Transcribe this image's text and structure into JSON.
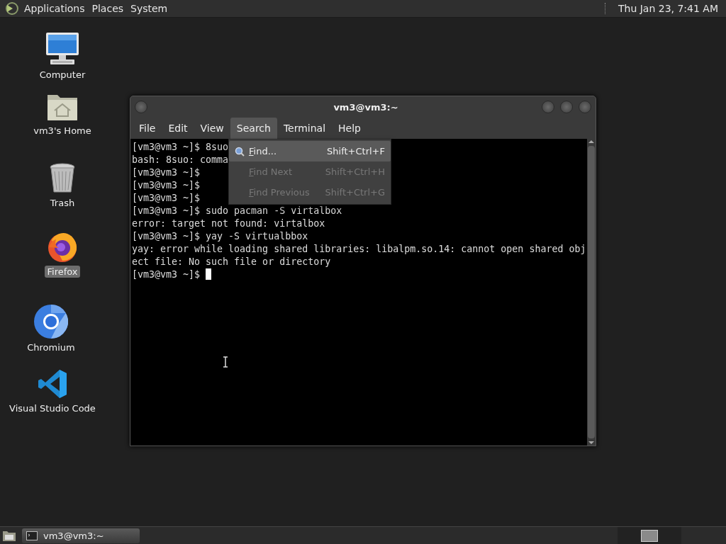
{
  "top_panel": {
    "menus": [
      "Applications",
      "Places",
      "System"
    ],
    "clock": "Thu Jan 23, 7:41 AM"
  },
  "desktop_icons": [
    {
      "label": "Computer",
      "kind": "computer",
      "selected": false
    },
    {
      "label": "vm3's Home",
      "kind": "home",
      "selected": false
    },
    {
      "label": "Trash",
      "kind": "trash",
      "selected": false
    },
    {
      "label": "Firefox",
      "kind": "firefox",
      "selected": true
    },
    {
      "label": "Chromium",
      "kind": "chromium",
      "selected": false
    },
    {
      "label": "Visual Studio Code",
      "kind": "vscode",
      "selected": false
    }
  ],
  "window": {
    "title": "vm3@vm3:~",
    "menus": [
      {
        "label": "File",
        "selected": false
      },
      {
        "label": "Edit",
        "selected": false
      },
      {
        "label": "View",
        "selected": false
      },
      {
        "label": "Search",
        "selected": true
      },
      {
        "label": "Terminal",
        "selected": false
      },
      {
        "label": "Help",
        "selected": false
      }
    ],
    "terminal_lines": [
      "[vm3@vm3 ~]$ 8suo",
      "bash: 8suo: comma",
      "[vm3@vm3 ~]$",
      "[vm3@vm3 ~]$",
      "[vm3@vm3 ~]$",
      "[vm3@vm3 ~]$ sudo pacman -S virtalbox",
      "error: target not found: virtalbox",
      "[vm3@vm3 ~]$ yay -S virtualbbox",
      "yay: error while loading shared libraries: libalpm.so.14: cannot open shared obj",
      "ect file: No such file or directory",
      "[vm3@vm3 ~]$"
    ],
    "search_menu": [
      {
        "label": "Find...",
        "shortcut": "Shift+Ctrl+F",
        "selected": true,
        "disabled": false
      },
      {
        "label": "Find Next",
        "shortcut": "Shift+Ctrl+H",
        "selected": false,
        "disabled": true
      },
      {
        "label": "Find Previous",
        "shortcut": "Shift+Ctrl+G",
        "selected": false,
        "disabled": true
      }
    ]
  },
  "taskbar": {
    "tasks": [
      "vm3@vm3:~"
    ]
  }
}
